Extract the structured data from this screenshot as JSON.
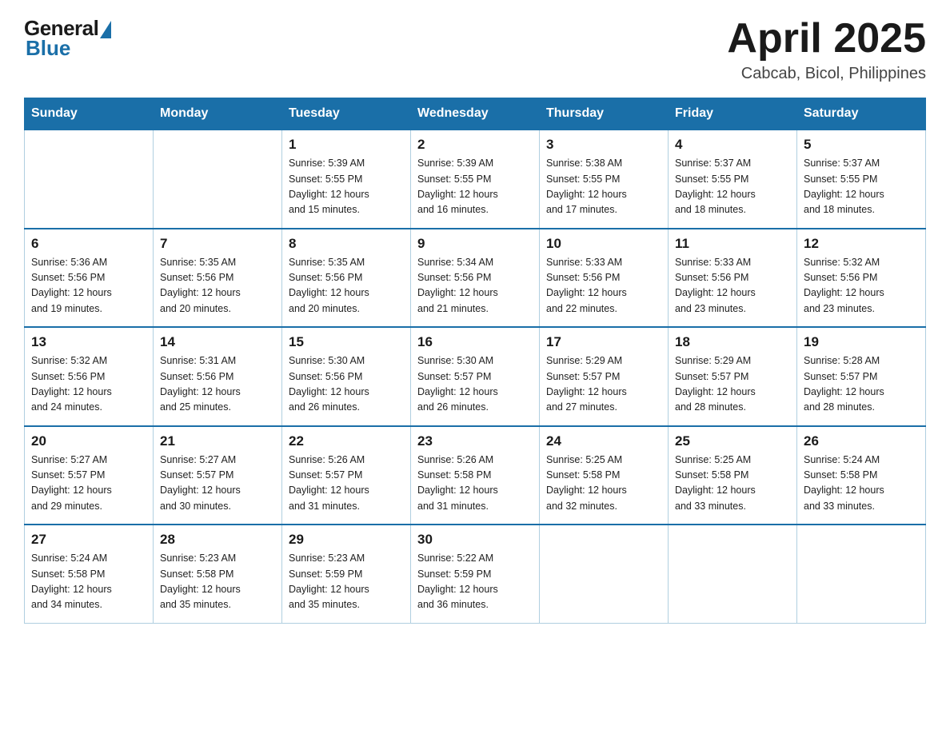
{
  "header": {
    "logo": {
      "general": "General",
      "blue": "Blue"
    },
    "title": "April 2025",
    "subtitle": "Cabcab, Bicol, Philippines"
  },
  "calendar": {
    "days_of_week": [
      "Sunday",
      "Monday",
      "Tuesday",
      "Wednesday",
      "Thursday",
      "Friday",
      "Saturday"
    ],
    "weeks": [
      [
        {
          "day": "",
          "info": ""
        },
        {
          "day": "",
          "info": ""
        },
        {
          "day": "1",
          "info": "Sunrise: 5:39 AM\nSunset: 5:55 PM\nDaylight: 12 hours\nand 15 minutes."
        },
        {
          "day": "2",
          "info": "Sunrise: 5:39 AM\nSunset: 5:55 PM\nDaylight: 12 hours\nand 16 minutes."
        },
        {
          "day": "3",
          "info": "Sunrise: 5:38 AM\nSunset: 5:55 PM\nDaylight: 12 hours\nand 17 minutes."
        },
        {
          "day": "4",
          "info": "Sunrise: 5:37 AM\nSunset: 5:55 PM\nDaylight: 12 hours\nand 18 minutes."
        },
        {
          "day": "5",
          "info": "Sunrise: 5:37 AM\nSunset: 5:55 PM\nDaylight: 12 hours\nand 18 minutes."
        }
      ],
      [
        {
          "day": "6",
          "info": "Sunrise: 5:36 AM\nSunset: 5:56 PM\nDaylight: 12 hours\nand 19 minutes."
        },
        {
          "day": "7",
          "info": "Sunrise: 5:35 AM\nSunset: 5:56 PM\nDaylight: 12 hours\nand 20 minutes."
        },
        {
          "day": "8",
          "info": "Sunrise: 5:35 AM\nSunset: 5:56 PM\nDaylight: 12 hours\nand 20 minutes."
        },
        {
          "day": "9",
          "info": "Sunrise: 5:34 AM\nSunset: 5:56 PM\nDaylight: 12 hours\nand 21 minutes."
        },
        {
          "day": "10",
          "info": "Sunrise: 5:33 AM\nSunset: 5:56 PM\nDaylight: 12 hours\nand 22 minutes."
        },
        {
          "day": "11",
          "info": "Sunrise: 5:33 AM\nSunset: 5:56 PM\nDaylight: 12 hours\nand 23 minutes."
        },
        {
          "day": "12",
          "info": "Sunrise: 5:32 AM\nSunset: 5:56 PM\nDaylight: 12 hours\nand 23 minutes."
        }
      ],
      [
        {
          "day": "13",
          "info": "Sunrise: 5:32 AM\nSunset: 5:56 PM\nDaylight: 12 hours\nand 24 minutes."
        },
        {
          "day": "14",
          "info": "Sunrise: 5:31 AM\nSunset: 5:56 PM\nDaylight: 12 hours\nand 25 minutes."
        },
        {
          "day": "15",
          "info": "Sunrise: 5:30 AM\nSunset: 5:56 PM\nDaylight: 12 hours\nand 26 minutes."
        },
        {
          "day": "16",
          "info": "Sunrise: 5:30 AM\nSunset: 5:57 PM\nDaylight: 12 hours\nand 26 minutes."
        },
        {
          "day": "17",
          "info": "Sunrise: 5:29 AM\nSunset: 5:57 PM\nDaylight: 12 hours\nand 27 minutes."
        },
        {
          "day": "18",
          "info": "Sunrise: 5:29 AM\nSunset: 5:57 PM\nDaylight: 12 hours\nand 28 minutes."
        },
        {
          "day": "19",
          "info": "Sunrise: 5:28 AM\nSunset: 5:57 PM\nDaylight: 12 hours\nand 28 minutes."
        }
      ],
      [
        {
          "day": "20",
          "info": "Sunrise: 5:27 AM\nSunset: 5:57 PM\nDaylight: 12 hours\nand 29 minutes."
        },
        {
          "day": "21",
          "info": "Sunrise: 5:27 AM\nSunset: 5:57 PM\nDaylight: 12 hours\nand 30 minutes."
        },
        {
          "day": "22",
          "info": "Sunrise: 5:26 AM\nSunset: 5:57 PM\nDaylight: 12 hours\nand 31 minutes."
        },
        {
          "day": "23",
          "info": "Sunrise: 5:26 AM\nSunset: 5:58 PM\nDaylight: 12 hours\nand 31 minutes."
        },
        {
          "day": "24",
          "info": "Sunrise: 5:25 AM\nSunset: 5:58 PM\nDaylight: 12 hours\nand 32 minutes."
        },
        {
          "day": "25",
          "info": "Sunrise: 5:25 AM\nSunset: 5:58 PM\nDaylight: 12 hours\nand 33 minutes."
        },
        {
          "day": "26",
          "info": "Sunrise: 5:24 AM\nSunset: 5:58 PM\nDaylight: 12 hours\nand 33 minutes."
        }
      ],
      [
        {
          "day": "27",
          "info": "Sunrise: 5:24 AM\nSunset: 5:58 PM\nDaylight: 12 hours\nand 34 minutes."
        },
        {
          "day": "28",
          "info": "Sunrise: 5:23 AM\nSunset: 5:58 PM\nDaylight: 12 hours\nand 35 minutes."
        },
        {
          "day": "29",
          "info": "Sunrise: 5:23 AM\nSunset: 5:59 PM\nDaylight: 12 hours\nand 35 minutes."
        },
        {
          "day": "30",
          "info": "Sunrise: 5:22 AM\nSunset: 5:59 PM\nDaylight: 12 hours\nand 36 minutes."
        },
        {
          "day": "",
          "info": ""
        },
        {
          "day": "",
          "info": ""
        },
        {
          "day": "",
          "info": ""
        }
      ]
    ]
  }
}
